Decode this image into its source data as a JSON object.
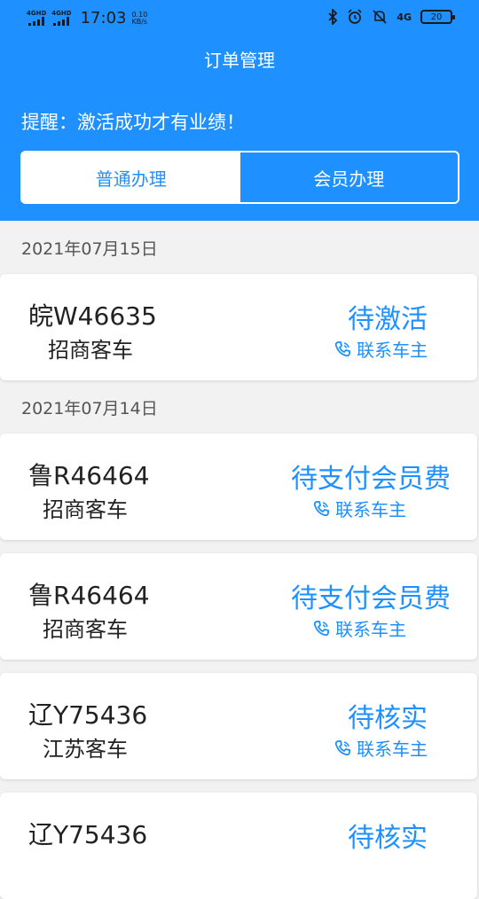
{
  "status_bar": {
    "net1": "4GHD",
    "net2": "4GHD",
    "time": "17:03",
    "speed_value": "0.10",
    "speed_unit": "KB/s",
    "net3": "4G",
    "battery": "20",
    "icons": [
      "bluetooth-icon",
      "alarm-icon",
      "mute-icon"
    ]
  },
  "header": {
    "title": "订单管理",
    "reminder": "提醒：激活成功才有业绩！",
    "tabs": [
      {
        "label": "普通办理",
        "active": true
      },
      {
        "label": "会员办理",
        "active": false
      }
    ]
  },
  "groups": [
    {
      "date": "2021年07月15日",
      "orders": [
        {
          "plate": "皖W46635",
          "type": "招商客车",
          "status": "待激活",
          "contact": "联系车主"
        }
      ]
    },
    {
      "date": "2021年07月14日",
      "orders": [
        {
          "plate": "鲁R46464",
          "type": "招商客车",
          "status": "待支付会员费",
          "contact": "联系车主"
        },
        {
          "plate": "鲁R46464",
          "type": "招商客车",
          "status": "待支付会员费",
          "contact": "联系车主"
        },
        {
          "plate": "辽Y75436",
          "type": "江苏客车",
          "status": "待核实",
          "contact": "联系车主"
        },
        {
          "plate": "辽Y75436",
          "type": "",
          "status": "待核实",
          "contact": ""
        }
      ]
    }
  ],
  "colors": {
    "accent": "#1e90ff",
    "background": "#f2f2f2"
  }
}
